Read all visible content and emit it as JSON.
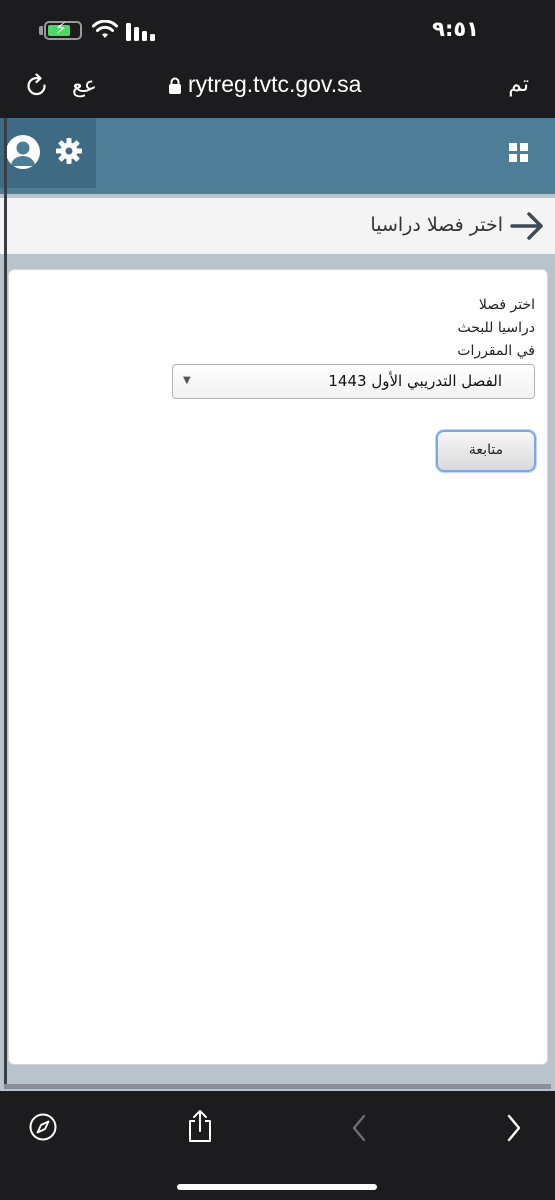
{
  "status_bar": {
    "time": "٩:٥١"
  },
  "browser": {
    "text_size_label": "ﻋﻊ",
    "url": "rytreg.tvtc.gov.sa",
    "done_label": "تم"
  },
  "page": {
    "title": "اختر فصلا دراسيا",
    "form": {
      "label_lines": [
        "اختر فصلا",
        "دراسيا للبحث",
        "في المقررات"
      ],
      "term_select_value": "الفصل التدريبي الأول 1443",
      "continue_label": "متابعة"
    }
  },
  "colors": {
    "header_bg": "#4e7d97",
    "header_left_bg": "#3f6a83",
    "battery_green": "#4cd964",
    "button_focus": "#7aa7e8"
  },
  "icons": [
    "wifi-icon",
    "signal-icon",
    "battery-icon",
    "reload-icon",
    "lock-icon",
    "user-avatar-icon",
    "gear-icon",
    "grid-icon",
    "back-arrow-icon",
    "compass-icon",
    "share-icon",
    "chevron-left-icon",
    "chevron-right-icon"
  ]
}
